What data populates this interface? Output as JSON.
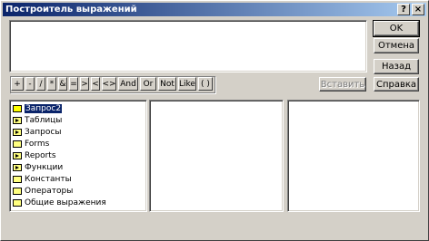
{
  "window": {
    "title": "Построитель выражений"
  },
  "titlebar": {
    "help": "?",
    "close": "×"
  },
  "buttons": {
    "ok": "OK",
    "cancel": "Отмена",
    "back": "Назад",
    "paste": "Вставить",
    "help": "Справка"
  },
  "operators": [
    "+",
    "-",
    "/",
    "*",
    "&",
    "=",
    ">",
    "<",
    "<>",
    "And",
    "Or",
    "Not",
    "Like",
    "( )"
  ],
  "tree": [
    {
      "label": "Запрос2",
      "icon": "folder-open-icon",
      "selected": true,
      "expand": false
    },
    {
      "label": "Таблицы",
      "icon": "folder-plus-icon",
      "selected": false,
      "expand": true
    },
    {
      "label": "Запросы",
      "icon": "folder-plus-icon",
      "selected": false,
      "expand": true
    },
    {
      "label": "Forms",
      "icon": "folder-icon",
      "selected": false,
      "expand": false
    },
    {
      "label": "Reports",
      "icon": "folder-plus-icon",
      "selected": false,
      "expand": true
    },
    {
      "label": "Функции",
      "icon": "folder-plus-icon",
      "selected": false,
      "expand": true
    },
    {
      "label": "Константы",
      "icon": "folder-icon",
      "selected": false,
      "expand": false
    },
    {
      "label": "Операторы",
      "icon": "folder-icon",
      "selected": false,
      "expand": false
    },
    {
      "label": "Общие выражения",
      "icon": "folder-icon",
      "selected": false,
      "expand": false
    }
  ]
}
